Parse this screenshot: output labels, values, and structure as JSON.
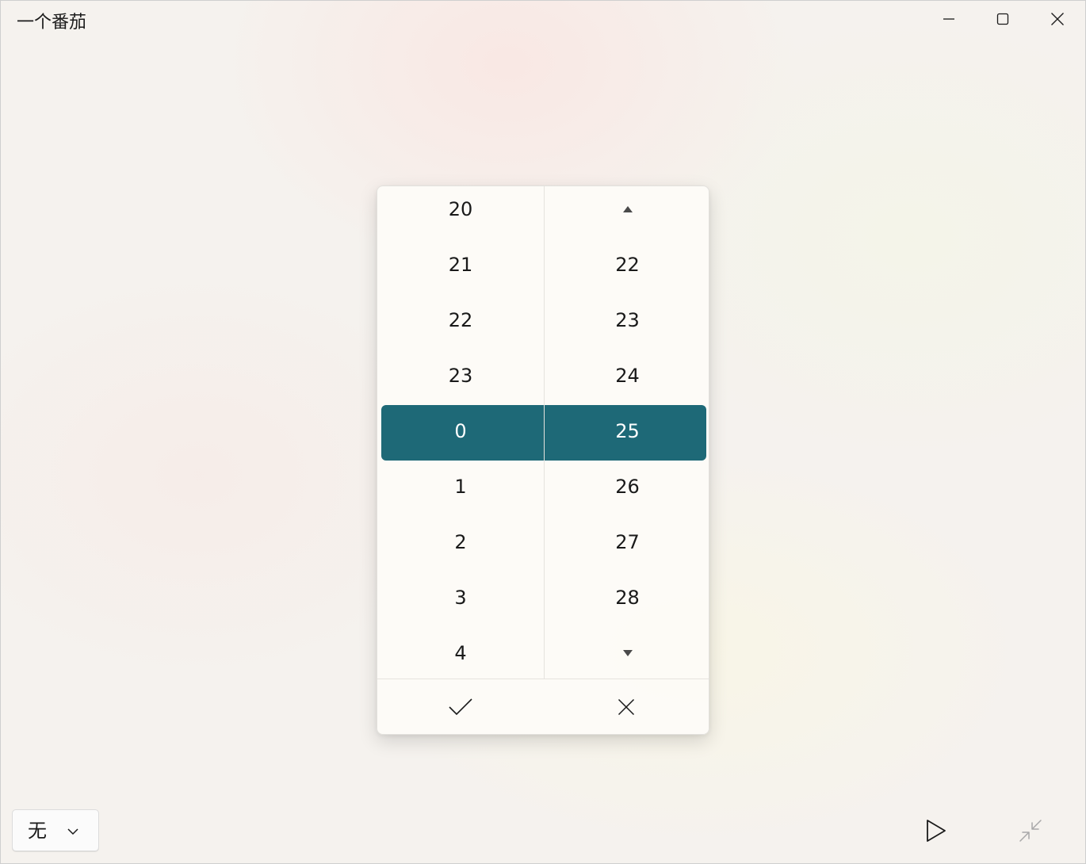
{
  "window": {
    "title": "一个番茄",
    "controls": [
      "minimize-icon",
      "maximize-icon",
      "close-icon"
    ]
  },
  "time_picker": {
    "hours": {
      "up_arrow": "triangle-up-icon",
      "items": [
        "20",
        "21",
        "22",
        "23",
        "0",
        "1",
        "2",
        "3",
        "4"
      ],
      "selected": "0"
    },
    "minutes": {
      "up_arrow": "triangle-up-icon",
      "items": [
        "22",
        "23",
        "24",
        "25",
        "26",
        "27",
        "28"
      ],
      "selected": "25",
      "down_arrow": "triangle-down-icon"
    },
    "accept_icon": "checkmark-icon",
    "dismiss_icon": "close-icon",
    "accent_color": "#1e6977"
  },
  "bottom_bar": {
    "dropdown": {
      "selected": "无",
      "icon": "chevron-down-icon"
    },
    "play_icon": "play-icon",
    "compact_icon": "shrink-icon"
  }
}
